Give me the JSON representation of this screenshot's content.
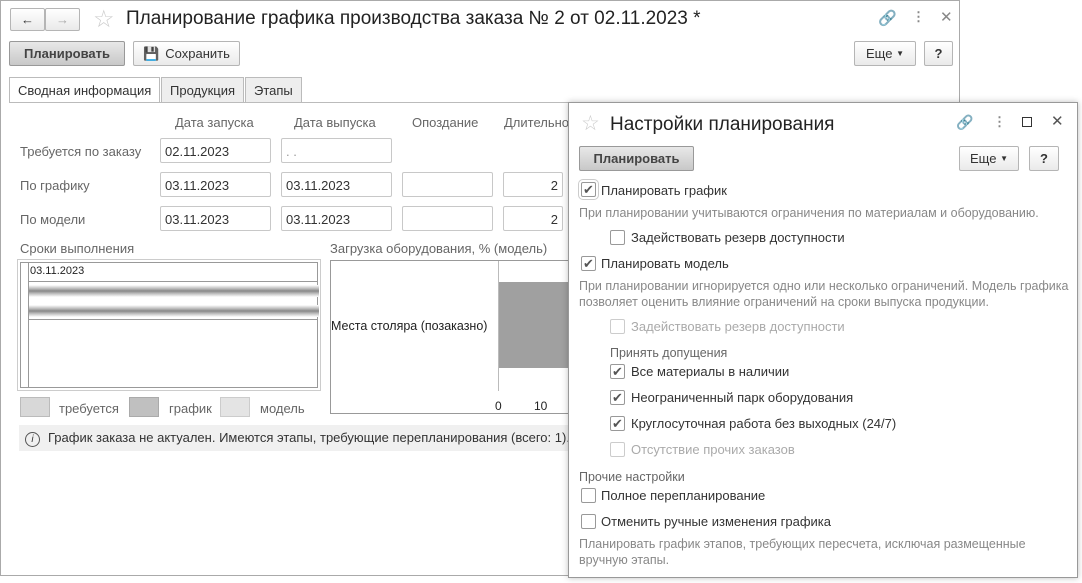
{
  "main": {
    "title": "Планирование графика производства заказа № 2 от 02.11.2023 *",
    "plan_button": "Планировать",
    "save_button": "Сохранить",
    "more_button": "Еще",
    "help_button": "?",
    "tabs": [
      {
        "label": "Сводная информация",
        "active": true
      },
      {
        "label": "Продукция"
      },
      {
        "label": "Этапы"
      }
    ],
    "columns": [
      "Дата запуска",
      "Дата выпуска",
      "Опоздание",
      "Длительно"
    ],
    "rows": [
      {
        "label": "Требуется по заказу",
        "start": "02.11.2023",
        "end": ". ."
      },
      {
        "label": "По графику",
        "start": "03.11.2023",
        "end": "03.11.2023",
        "delay": "",
        "duration": "2"
      },
      {
        "label": "По модели",
        "start": "03.11.2023",
        "end": "03.11.2023",
        "delay": "",
        "duration": "2"
      }
    ],
    "timeline": {
      "title": "Сроки выполнения",
      "date": "03.11.2023"
    },
    "legend": [
      {
        "label": "требуется",
        "color": "#d8d8d8"
      },
      {
        "label": "график",
        "color": "#c0c0c0"
      },
      {
        "label": "модель",
        "color": "#e4e4e4"
      }
    ],
    "load_chart": {
      "title": "Загрузка оборудования, % (модель)",
      "category": "Места столяра (позаказно)",
      "ticks": [
        "0",
        "10"
      ],
      "bar_color": "#a0a0a0"
    },
    "info": "График заказа не актуален. Имеются этапы, требующие перепланирования (всего: 1)."
  },
  "dialog": {
    "title": "Настройки планирования",
    "plan_button": "Планировать",
    "more_button": "Еще",
    "help_button": "?",
    "plan_schedule": {
      "label": "Планировать график",
      "checked": true
    },
    "plan_schedule_note": "При планировании учитываются ограничения по материалам и оборудованию.",
    "reserve1": {
      "label": "Задействовать резерв доступности",
      "checked": false
    },
    "plan_model": {
      "label": "Планировать модель",
      "checked": true
    },
    "plan_model_note": "При планировании игнорируется одно или несколько ограничений. Модель графика позволяет оценить влияние ограничений на сроки выпуска продукции.",
    "reserve2": {
      "label": "Задействовать резерв доступности",
      "checked": false,
      "disabled": true
    },
    "assumptions_title": "Принять допущения",
    "assumptions": [
      {
        "label": "Все материалы в наличии",
        "checked": true
      },
      {
        "label": "Неограниченный парк оборудования",
        "checked": true
      },
      {
        "label": "Круглосуточная работа без выходных (24/7)",
        "checked": true
      },
      {
        "label": "Отсутствие прочих заказов",
        "checked": false,
        "disabled": true
      }
    ],
    "other_title": "Прочие настройки",
    "full_replan": {
      "label": "Полное перепланирование",
      "checked": false
    },
    "cancel_manual": {
      "label": "Отменить ручные изменения графика",
      "checked": false
    },
    "cancel_manual_note": "Планировать график этапов, требующих пересчета, исключая размещенные вручную этапы."
  }
}
